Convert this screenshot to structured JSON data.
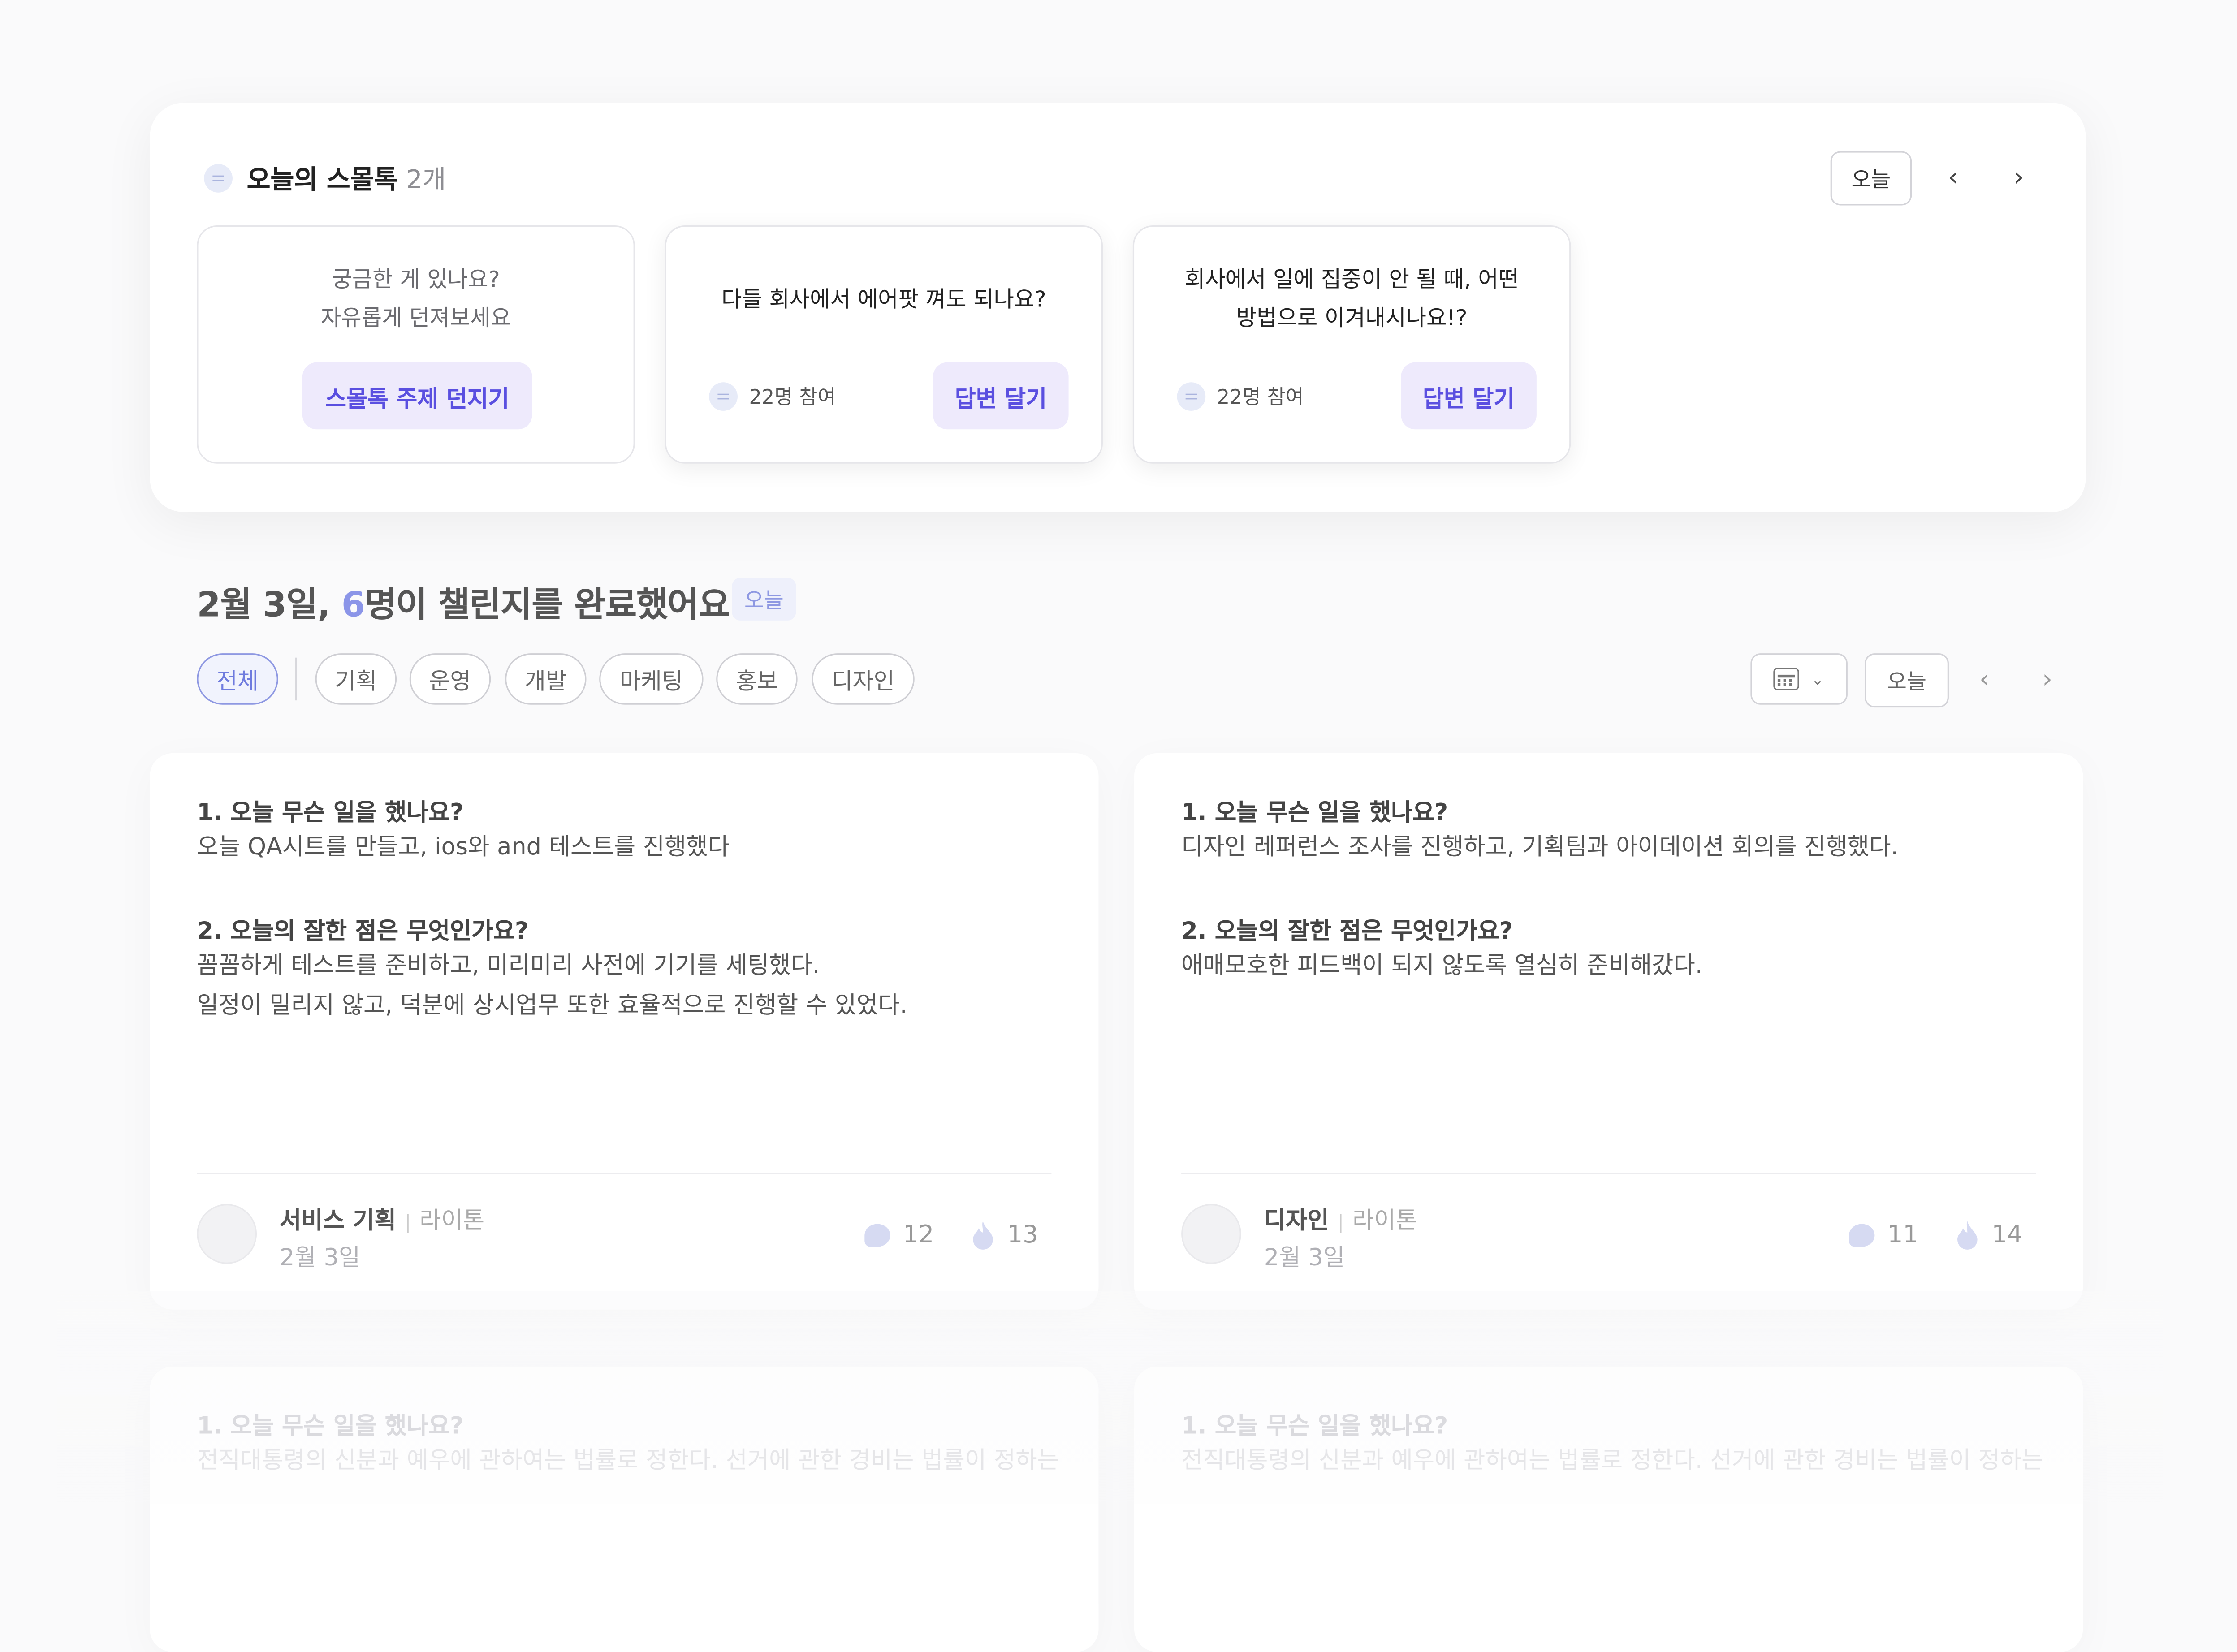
{
  "smalltalk": {
    "title": "오늘의 스몰톡",
    "count": "2개",
    "today_label": "오늘",
    "prompt_card": {
      "line1": "궁금한 게 있나요?",
      "line2": "자유롭게 던져보세요",
      "button": "스몰톡 주제 던지기"
    },
    "topics": [
      {
        "line1": "다들 회사에서 에어팟 껴도 되나요?",
        "line2": "",
        "participants": "22명 참여",
        "button": "답변 달기"
      },
      {
        "line1": "회사에서 일에 집중이 안 될 때, 어떤",
        "line2": "방법으로 이겨내시나요!?",
        "participants": "22명 참여",
        "button": "답변 달기"
      }
    ]
  },
  "challenge": {
    "heading_prefix": "2월 3일, ",
    "heading_number": "6",
    "heading_suffix": "명이 챌린지를 완료했어요.",
    "today_badge": "오늘",
    "filters": [
      "전체",
      "기획",
      "운영",
      "개발",
      "마케팅",
      "홍보",
      "디자인"
    ],
    "today_label": "오늘"
  },
  "posts": [
    {
      "q1": "1. 오늘 무슨 일을 했나요?",
      "a1": [
        "오늘 QA시트를 만들고, ios와 and 테스트를 진행했다"
      ],
      "q2": "2. 오늘의 잘한 점은 무엇인가요?",
      "a2": [
        "꼼꼼하게 테스트를 준비하고, 미리미리 사전에 기기를 세팅했다.",
        "일정이 밀리지 않고, 덕분에 상시업무 또한 효율적으로 진행할 수 있었다."
      ],
      "team": "서비스 기획",
      "role": "라이톤",
      "date": "2월 3일",
      "comments": "12",
      "likes": "13"
    },
    {
      "q1": "1. 오늘 무슨 일을 했나요?",
      "a1": [
        "디자인 레퍼런스 조사를 진행하고, 기획팀과 아이데이션 회의를 진행했다."
      ],
      "q2": "2. 오늘의 잘한 점은 무엇인가요?",
      "a2": [
        "애매모호한 피드백이 되지 않도록 열심히 준비해갔다."
      ],
      "team": "디자인",
      "role": "라이톤",
      "date": "2월 3일",
      "comments": "11",
      "likes": "14"
    }
  ],
  "faded_posts": [
    {
      "q1": "1. 오늘 무슨 일을 했나요?",
      "a1": "전직대통령의 신분과 예우에 관하여는 법률로 정한다. 선거에 관한 경비는 법률이 정하는"
    },
    {
      "q1": "1. 오늘 무슨 일을 했나요?",
      "a1": "전직대통령의 신분과 예우에 관하여는 법률로 정한다. 선거에 관한 경비는 법률이 정하는"
    }
  ],
  "colors": {
    "accent": "#5a4fe0",
    "accent_soft": "#eeeafc",
    "heading_number": "#8b95e8",
    "chip_active": "#6f7bde"
  },
  "icons": {
    "bubble": "chat-bubble-icon",
    "prev": "chevron-left-icon",
    "next": "chevron-right-icon",
    "calendar": "calendar-icon",
    "comment": "comment-icon",
    "fire": "fire-icon"
  }
}
